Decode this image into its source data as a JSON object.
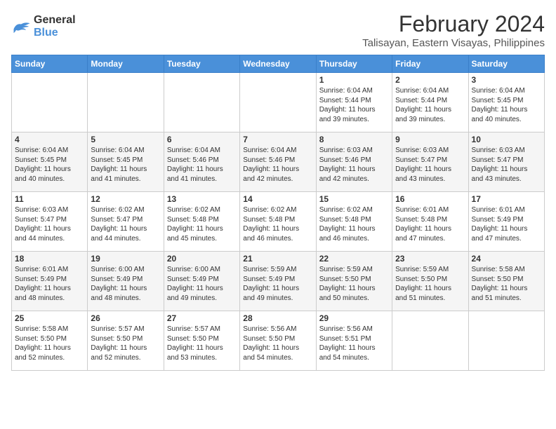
{
  "logo": {
    "text_general": "General",
    "text_blue": "Blue"
  },
  "title": "February 2024",
  "subtitle": "Talisayan, Eastern Visayas, Philippines",
  "days_of_week": [
    "Sunday",
    "Monday",
    "Tuesday",
    "Wednesday",
    "Thursday",
    "Friday",
    "Saturday"
  ],
  "weeks": [
    [
      {
        "day": "",
        "info": ""
      },
      {
        "day": "",
        "info": ""
      },
      {
        "day": "",
        "info": ""
      },
      {
        "day": "",
        "info": ""
      },
      {
        "day": "1",
        "info": "Sunrise: 6:04 AM\nSunset: 5:44 PM\nDaylight: 11 hours\nand 39 minutes."
      },
      {
        "day": "2",
        "info": "Sunrise: 6:04 AM\nSunset: 5:44 PM\nDaylight: 11 hours\nand 39 minutes."
      },
      {
        "day": "3",
        "info": "Sunrise: 6:04 AM\nSunset: 5:45 PM\nDaylight: 11 hours\nand 40 minutes."
      }
    ],
    [
      {
        "day": "4",
        "info": "Sunrise: 6:04 AM\nSunset: 5:45 PM\nDaylight: 11 hours\nand 40 minutes."
      },
      {
        "day": "5",
        "info": "Sunrise: 6:04 AM\nSunset: 5:45 PM\nDaylight: 11 hours\nand 41 minutes."
      },
      {
        "day": "6",
        "info": "Sunrise: 6:04 AM\nSunset: 5:46 PM\nDaylight: 11 hours\nand 41 minutes."
      },
      {
        "day": "7",
        "info": "Sunrise: 6:04 AM\nSunset: 5:46 PM\nDaylight: 11 hours\nand 42 minutes."
      },
      {
        "day": "8",
        "info": "Sunrise: 6:03 AM\nSunset: 5:46 PM\nDaylight: 11 hours\nand 42 minutes."
      },
      {
        "day": "9",
        "info": "Sunrise: 6:03 AM\nSunset: 5:47 PM\nDaylight: 11 hours\nand 43 minutes."
      },
      {
        "day": "10",
        "info": "Sunrise: 6:03 AM\nSunset: 5:47 PM\nDaylight: 11 hours\nand 43 minutes."
      }
    ],
    [
      {
        "day": "11",
        "info": "Sunrise: 6:03 AM\nSunset: 5:47 PM\nDaylight: 11 hours\nand 44 minutes."
      },
      {
        "day": "12",
        "info": "Sunrise: 6:02 AM\nSunset: 5:47 PM\nDaylight: 11 hours\nand 44 minutes."
      },
      {
        "day": "13",
        "info": "Sunrise: 6:02 AM\nSunset: 5:48 PM\nDaylight: 11 hours\nand 45 minutes."
      },
      {
        "day": "14",
        "info": "Sunrise: 6:02 AM\nSunset: 5:48 PM\nDaylight: 11 hours\nand 46 minutes."
      },
      {
        "day": "15",
        "info": "Sunrise: 6:02 AM\nSunset: 5:48 PM\nDaylight: 11 hours\nand 46 minutes."
      },
      {
        "day": "16",
        "info": "Sunrise: 6:01 AM\nSunset: 5:48 PM\nDaylight: 11 hours\nand 47 minutes."
      },
      {
        "day": "17",
        "info": "Sunrise: 6:01 AM\nSunset: 5:49 PM\nDaylight: 11 hours\nand 47 minutes."
      }
    ],
    [
      {
        "day": "18",
        "info": "Sunrise: 6:01 AM\nSunset: 5:49 PM\nDaylight: 11 hours\nand 48 minutes."
      },
      {
        "day": "19",
        "info": "Sunrise: 6:00 AM\nSunset: 5:49 PM\nDaylight: 11 hours\nand 48 minutes."
      },
      {
        "day": "20",
        "info": "Sunrise: 6:00 AM\nSunset: 5:49 PM\nDaylight: 11 hours\nand 49 minutes."
      },
      {
        "day": "21",
        "info": "Sunrise: 5:59 AM\nSunset: 5:49 PM\nDaylight: 11 hours\nand 49 minutes."
      },
      {
        "day": "22",
        "info": "Sunrise: 5:59 AM\nSunset: 5:50 PM\nDaylight: 11 hours\nand 50 minutes."
      },
      {
        "day": "23",
        "info": "Sunrise: 5:59 AM\nSunset: 5:50 PM\nDaylight: 11 hours\nand 51 minutes."
      },
      {
        "day": "24",
        "info": "Sunrise: 5:58 AM\nSunset: 5:50 PM\nDaylight: 11 hours\nand 51 minutes."
      }
    ],
    [
      {
        "day": "25",
        "info": "Sunrise: 5:58 AM\nSunset: 5:50 PM\nDaylight: 11 hours\nand 52 minutes."
      },
      {
        "day": "26",
        "info": "Sunrise: 5:57 AM\nSunset: 5:50 PM\nDaylight: 11 hours\nand 52 minutes."
      },
      {
        "day": "27",
        "info": "Sunrise: 5:57 AM\nSunset: 5:50 PM\nDaylight: 11 hours\nand 53 minutes."
      },
      {
        "day": "28",
        "info": "Sunrise: 5:56 AM\nSunset: 5:50 PM\nDaylight: 11 hours\nand 54 minutes."
      },
      {
        "day": "29",
        "info": "Sunrise: 5:56 AM\nSunset: 5:51 PM\nDaylight: 11 hours\nand 54 minutes."
      },
      {
        "day": "",
        "info": ""
      },
      {
        "day": "",
        "info": ""
      }
    ]
  ]
}
